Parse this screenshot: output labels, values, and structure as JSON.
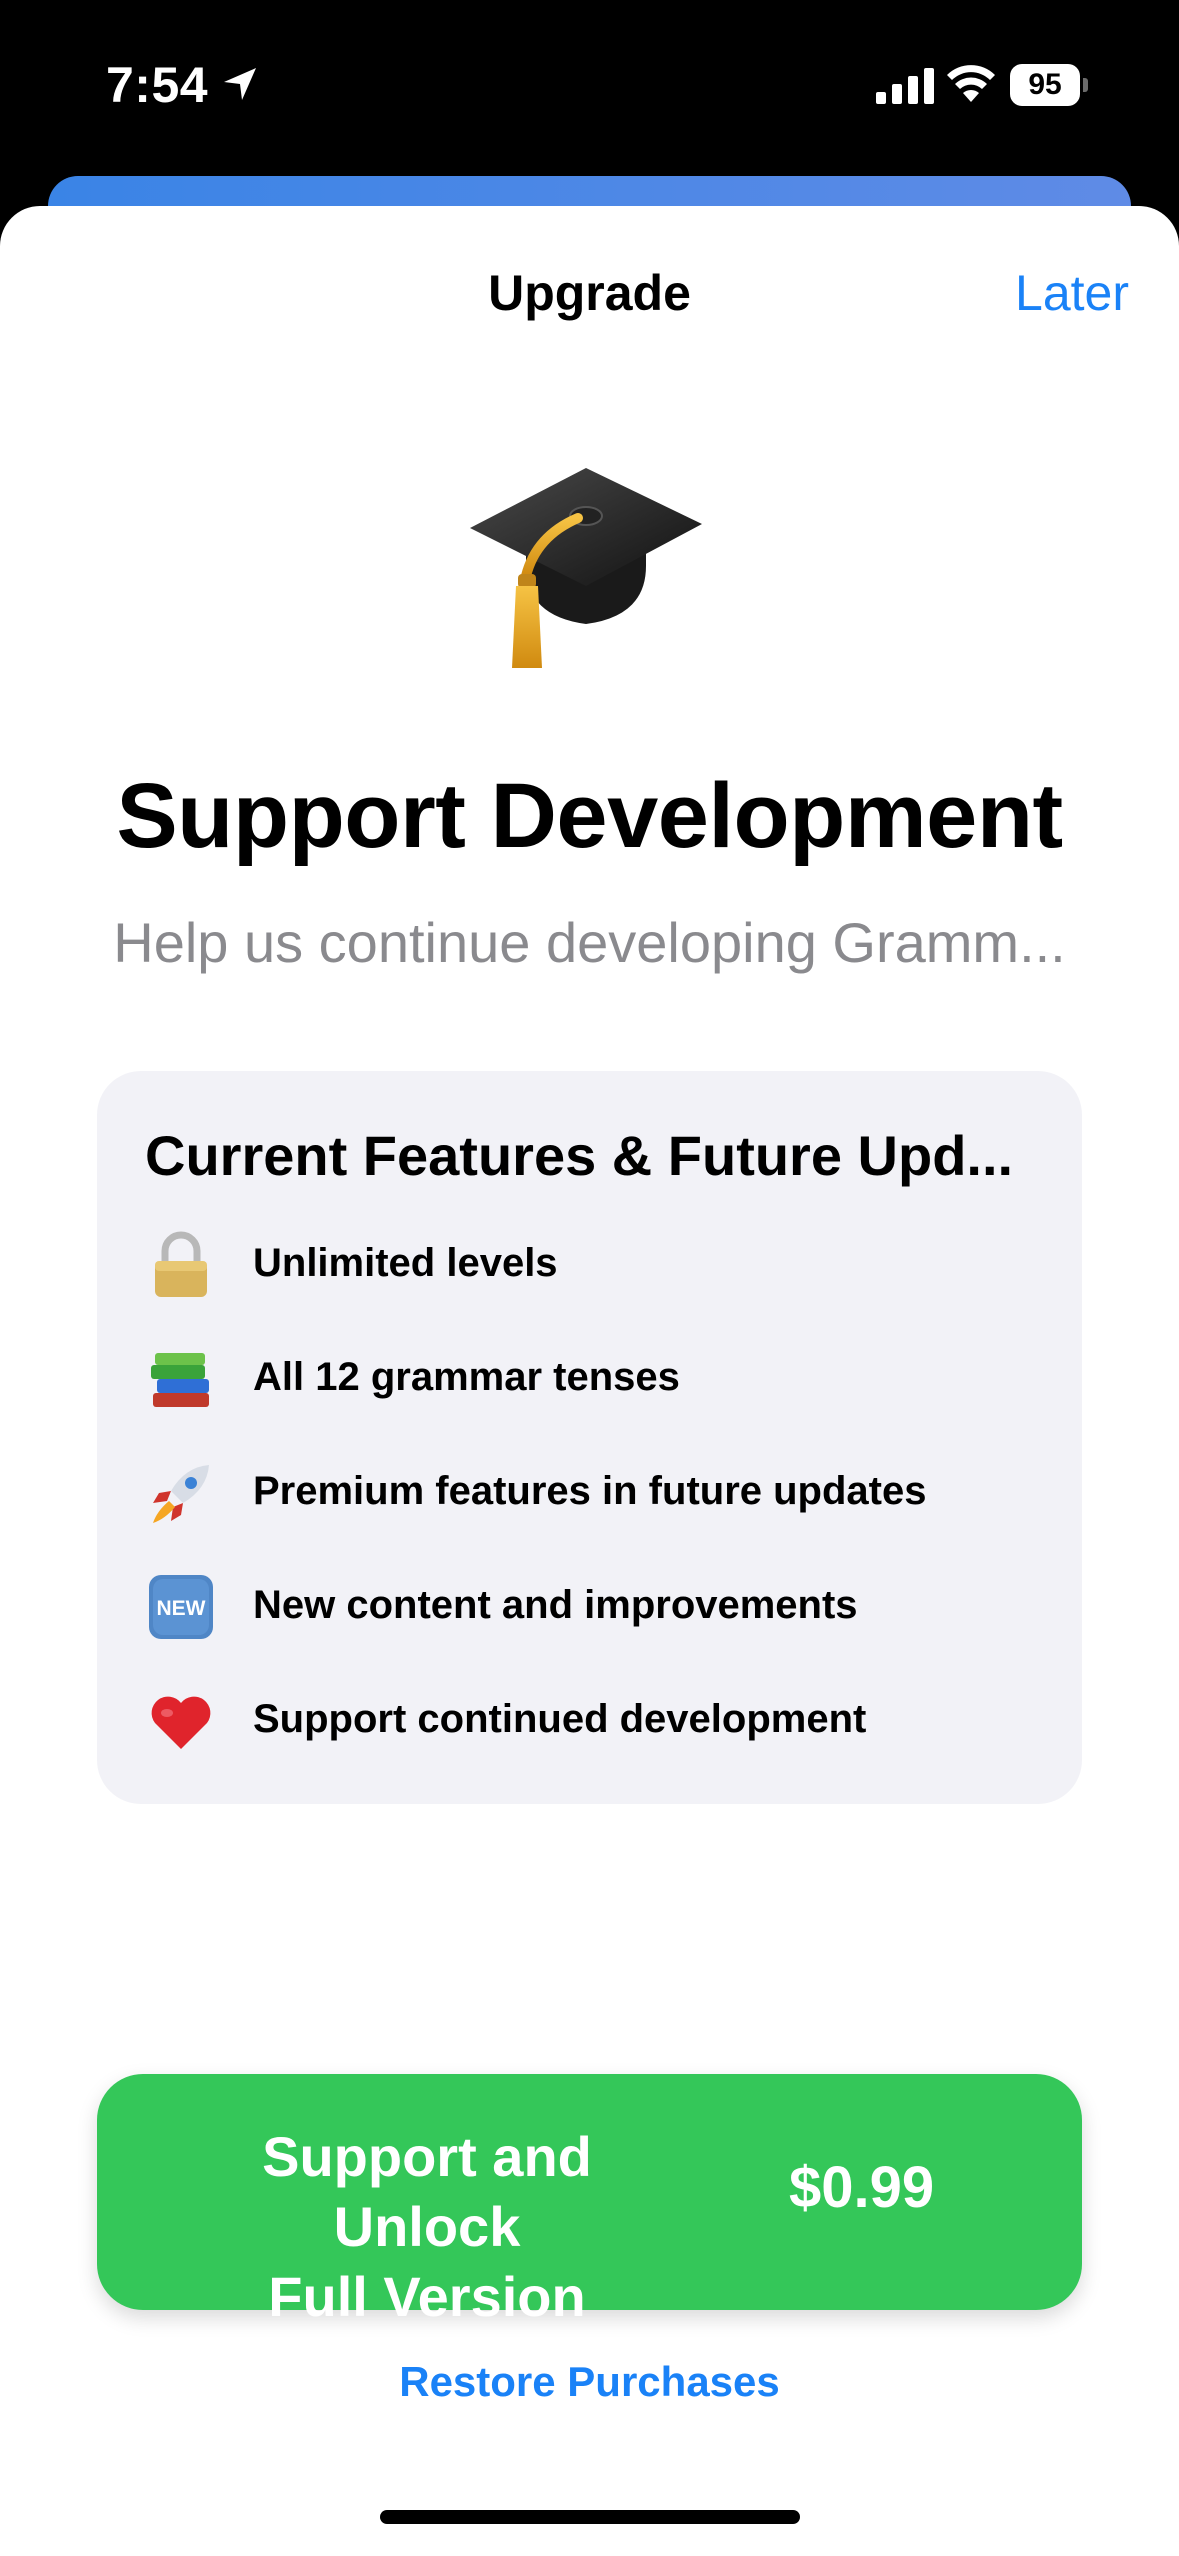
{
  "status_bar": {
    "time": "7:54",
    "battery": "95",
    "icons": [
      "location-arrow-icon",
      "cellular-signal-icon",
      "wifi-icon",
      "battery-icon"
    ]
  },
  "nav": {
    "title": "Upgrade",
    "later_label": "Later"
  },
  "hero": {
    "icon": "graduation-cap-icon",
    "headline": "Support Development",
    "subhead": "Help us continue developing Gramm..."
  },
  "features": {
    "title": "Current Features & Future Upd...",
    "items": [
      {
        "icon": "padlock-icon",
        "label": "Unlimited levels"
      },
      {
        "icon": "books-icon",
        "label": "All 12 grammar tenses"
      },
      {
        "icon": "rocket-icon",
        "label": "Premium features in future updates"
      },
      {
        "icon": "new-badge-icon",
        "label": "New content and improvements",
        "badge_text": "NEW"
      },
      {
        "icon": "heart-icon",
        "label": "Support continued development"
      }
    ]
  },
  "cta": {
    "line1": "Support and Unlock",
    "line2": "Full Version",
    "price": "$0.99",
    "color": "#34c759"
  },
  "restore_label": "Restore Purchases",
  "colors": {
    "accent": "#1a82f7",
    "cta_green": "#34c759",
    "card_bg": "#f2f2f7",
    "subtle_text": "#8a8a8e"
  }
}
